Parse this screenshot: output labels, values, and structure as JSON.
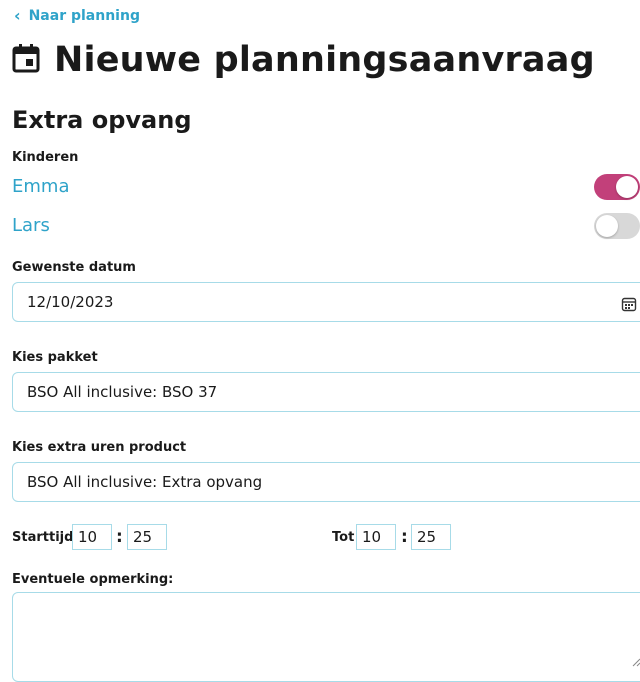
{
  "nav": {
    "back_label": "Naar planning",
    "back_icon": "chevron-left-icon"
  },
  "header": {
    "title": "Nieuwe planningsaanvraag",
    "icon": "calendar-icon"
  },
  "section": {
    "title": "Extra opvang"
  },
  "children": {
    "label": "Kinderen",
    "items": [
      {
        "name": "Emma",
        "selected": true
      },
      {
        "name": "Lars",
        "selected": false
      }
    ]
  },
  "date": {
    "label": "Gewenste datum",
    "value": "12/10/2023"
  },
  "package": {
    "label": "Kies pakket",
    "value": "BSO All inclusive: BSO 37"
  },
  "product": {
    "label": "Kies extra uren product",
    "value": "BSO All inclusive: Extra opvang"
  },
  "time": {
    "start_label": "Starttijd",
    "start_hour": "10",
    "start_minute": "25",
    "end_label": "Tot",
    "end_hour": "10",
    "end_minute": "25",
    "separator": ":"
  },
  "remarks": {
    "label": "Eventuele opmerking:",
    "value": ""
  },
  "colors": {
    "accent": "#2fa3c9",
    "toggle_on": "#c2407a",
    "toggle_off": "#d8d8d8",
    "border": "#a7dbe8"
  }
}
